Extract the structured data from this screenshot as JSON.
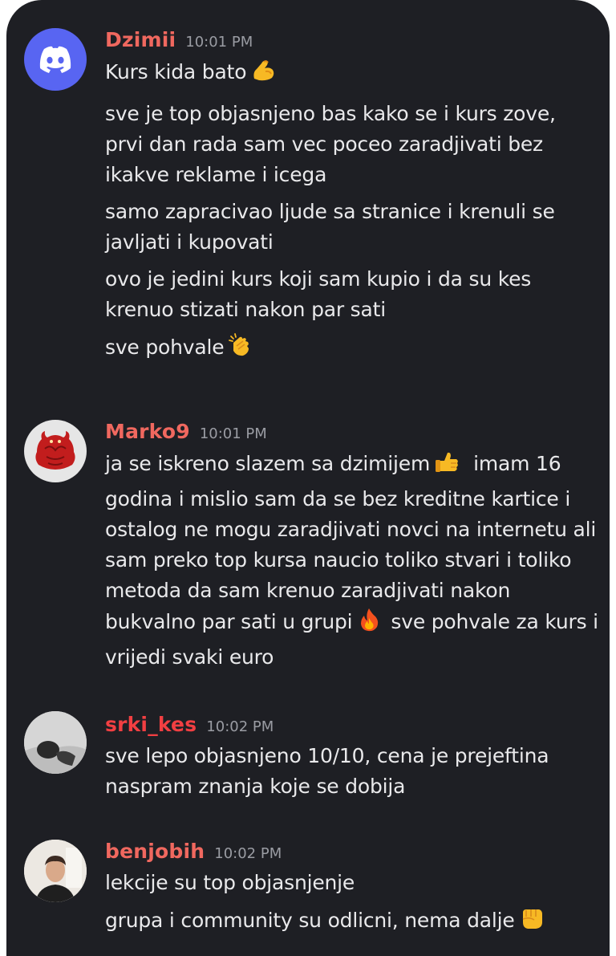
{
  "messages": [
    {
      "username": "Dzimii",
      "time": "10:01 PM",
      "avatar": "discord-logo",
      "lines": [
        {
          "text": "Kurs kida bato",
          "emoji": "flexed-biceps"
        },
        {
          "text": "sve je top objasnjeno bas kako se i kurs zove, prvi dan rada sam vec poceo zaradjivati bez ikakve reklame i icega"
        },
        {
          "text": "samo zapracivao ljude sa stranice i krenuli se javljati i kupovati"
        },
        {
          "text": "ovo je jedini kurs koji sam kupio i da su kes krenuo stizati nakon par sati"
        },
        {
          "text": "sve pohvale",
          "emoji": "clapping-hands"
        }
      ]
    },
    {
      "username": "Marko9",
      "time": "10:01 PM",
      "avatar": "red-bull-figure",
      "lines": [
        {
          "text_a": "ja se iskreno slazem sa dzimijem",
          "emoji_a": "thumbs-up",
          "text_b": "imam 16 godina i mislio sam da se bez kreditne kartice i ostalog ne mogu zaradjivati novci na internetu ali sam preko top kursa naucio toliko stvari i toliko metoda da sam krenuo zaradjivati nakon bukvalno par sati u grupi",
          "emoji_b": "fire",
          "text_c": "sve pohvale za kurs i vrijedi svaki euro"
        }
      ]
    },
    {
      "username": "srki_kes",
      "time": "10:02 PM",
      "avatar": "user-photo",
      "lines": [
        {
          "text": "sve lepo objasnjeno 10/10, cena je prejeftina naspram znanja koje se dobija"
        }
      ]
    },
    {
      "username": "benjobih",
      "time": "10:02 PM",
      "avatar": "user-photo",
      "lines": [
        {
          "text": "lekcije su top objasnjenje"
        },
        {
          "text": "grupa i community su odlicni, nema dalje",
          "emoji": "oncoming-fist"
        }
      ]
    }
  ],
  "colors": {
    "background": "#1e1f24",
    "username": "#f0685f",
    "timestamp": "#9a9ca3",
    "text": "#e9e9eb",
    "discord_blurple": "#5865f2"
  }
}
